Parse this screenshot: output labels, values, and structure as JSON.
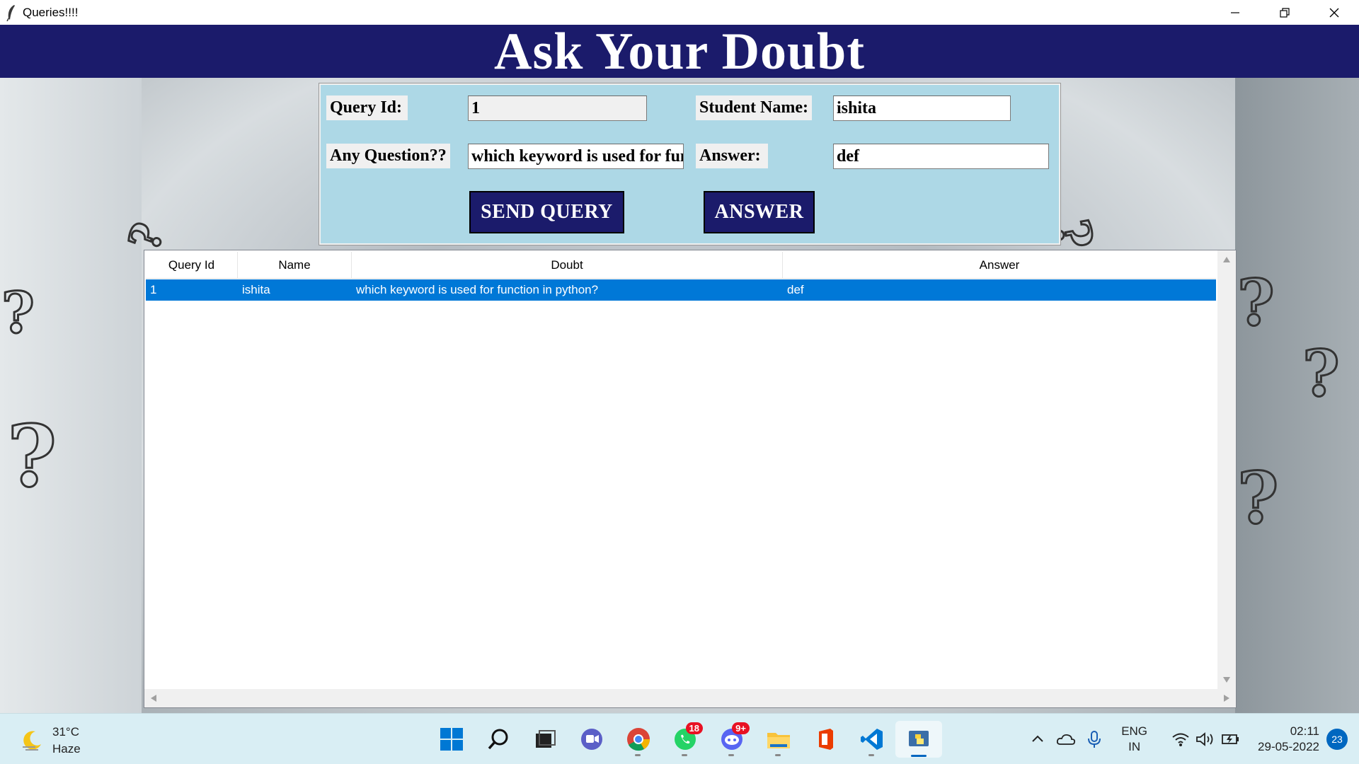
{
  "window": {
    "title": "Queries!!!!"
  },
  "header": {
    "title": "Ask Your Doubt"
  },
  "form": {
    "query_id_label": "Query Id:",
    "query_id_value": "1",
    "student_name_label": "Student Name:",
    "student_name_value": "ishita",
    "question_label": "Any Question??",
    "question_value": "which keyword is used for function in python?",
    "answer_label": "Answer:",
    "answer_value": "def",
    "send_button": "SEND QUERY",
    "answer_button": "ANSWER"
  },
  "table": {
    "columns": [
      "Query Id",
      "Name",
      "Doubt",
      "Answer"
    ],
    "rows": [
      {
        "query_id": "1",
        "name": "ishita",
        "doubt": "which keyword is used for function in python?",
        "answer": "def"
      }
    ]
  },
  "taskbar": {
    "weather_temp": "31°C",
    "weather_desc": "Haze",
    "whatsapp_badge": "18",
    "discord_badge": "9+",
    "lang_top": "ENG",
    "lang_bottom": "IN",
    "time": "02:11",
    "date": "29-05-2022",
    "notifications": "23"
  },
  "colors": {
    "header_bg": "#1b1b6b",
    "panel_bg": "#add8e6",
    "selection": "#0078d7",
    "taskbar_bg": "#d9eef4"
  }
}
